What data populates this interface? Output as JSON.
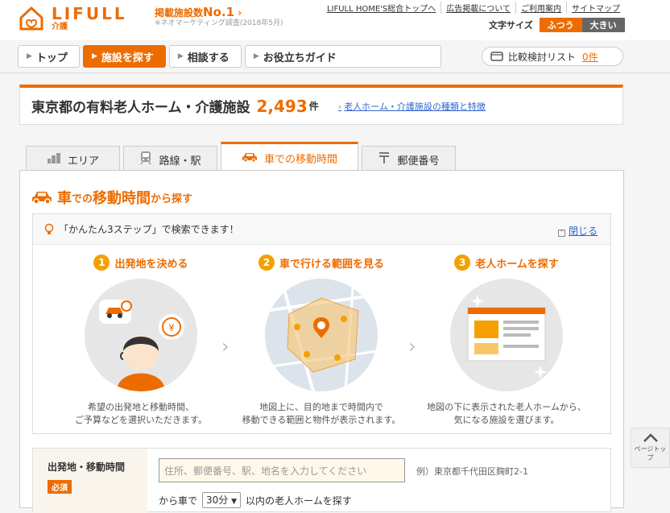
{
  "logo": {
    "word": "LIFULL",
    "sub": "介護"
  },
  "no1": {
    "prefix": "掲載施設数",
    "title_big": "No.1",
    "note": "※ネオマーケティング調査(2018年5月)"
  },
  "toplinks": [
    "LIFULL HOME'S総合トップへ",
    "広告掲載について",
    "ご利用案内",
    "サイトマップ"
  ],
  "fontsize": {
    "label": "文字サイズ",
    "normal": "ふつう",
    "large": "大きい"
  },
  "nav": [
    {
      "label": "トップ"
    },
    {
      "label": "施設を探す"
    },
    {
      "label": "相談する"
    },
    {
      "label": "お役立ちガイド"
    }
  ],
  "compare": {
    "label": "比較検討リスト",
    "count": "0件"
  },
  "heading": {
    "title": "東京都の有料老人ホーム・介護施設",
    "count": "2,493",
    "unit": "件",
    "link": "老人ホーム・介護施設の種類と特徴"
  },
  "tabs": [
    {
      "label": "エリア",
      "icon": "building-icon"
    },
    {
      "label": "路線・駅",
      "icon": "train-icon"
    },
    {
      "label": "車での移動時間",
      "icon": "car-icon"
    },
    {
      "label": "郵便番号",
      "icon": "postal-icon"
    }
  ],
  "panel": {
    "title_big1": "車",
    "title_small1": "での",
    "title_big2": "移動時間",
    "title_small2": "から探す"
  },
  "steps_box": {
    "head": "「かんたん3ステップ」で検索できます！",
    "close": "閉じる",
    "steps": [
      {
        "num": "1",
        "title": "出発地を決める",
        "desc1": "希望の出発地と移動時間、",
        "desc2": "ご予算などを選択いただきます。"
      },
      {
        "num": "2",
        "title": "車で行ける範囲を見る",
        "desc1": "地図上に、目的地まで時間内で",
        "desc2": "移動できる範囲と物件が表示されます。"
      },
      {
        "num": "3",
        "title": "老人ホームを探す",
        "desc1": "地図の下に表示された老人ホームから、",
        "desc2": "気になる施設を選びます。"
      }
    ]
  },
  "form": {
    "label": "出発地・移動時間",
    "required": "必須",
    "placeholder": "住所、郵便番号、駅、地名を入力してください",
    "example": "例）東京都千代田区麹町2-1",
    "from_car": "から車で",
    "minutes": "30分",
    "suffix": "以内の老人ホームを探す"
  },
  "pagetop": "ページトップ",
  "colors": {
    "accent": "#ed6c00",
    "link": "#3366cc"
  }
}
